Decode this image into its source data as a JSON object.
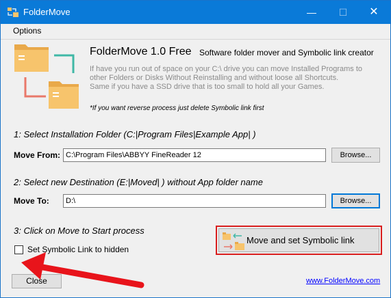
{
  "window": {
    "title": "FolderMove",
    "controls": {
      "minimize": "—",
      "maximize": "☐",
      "close": "✕"
    }
  },
  "menu": {
    "items": [
      "Options"
    ]
  },
  "header": {
    "app_name": "FolderMove 1.0 Free",
    "tagline": "Software folder mover and Symbolic link creator",
    "description": [
      "If have you run out of space on your C:\\ drive you can move Installed Programs to",
      "other Folders or Disks Without Reinstalling and without loose all Shortcuts.",
      "Same if you have a SSD drive that is too small to hold all your Games."
    ],
    "note": "*If you want reverse process just delete Symbolic link first"
  },
  "step1": {
    "label": "1: Select Installation Folder (C:|Program Files|Example App| )",
    "field_label": "Move From:",
    "value": "C:\\Program Files\\ABBYY FineReader 12",
    "browse": "Browse..."
  },
  "step2": {
    "label": "2: Select new Destination (E:|Moved| ) without App folder name",
    "field_label": "Move To:",
    "value": "D:\\",
    "browse": "Browse..."
  },
  "step3": {
    "label": "3: Click on Move to Start process",
    "checkbox_label": "Set Symbolic Link to hidden",
    "checkbox_checked": false,
    "move_button": "Move and set Symbolic link"
  },
  "footer": {
    "close": "Close",
    "link": "www.FolderMove.com"
  },
  "colors": {
    "titlebar": "#0a7ad8",
    "highlight_border": "#d91e1e",
    "annotation_arrow": "#e8141b",
    "folder": "#f7c46c",
    "arrow_green": "#3fb8a6",
    "arrow_red": "#e9786a",
    "link": "#0000ff"
  },
  "icons": {
    "app": "folder-move-app-icon",
    "logo": "folder-transfer-logo-icon",
    "move": "folder-transfer-small-icon",
    "annotation": "red-pointer-arrow"
  }
}
